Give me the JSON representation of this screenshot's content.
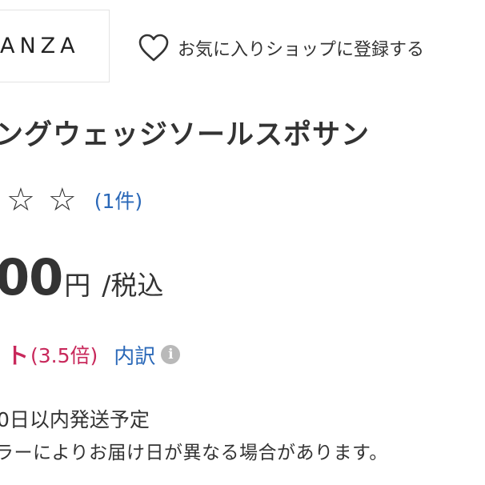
{
  "brand": {
    "logo_text": "ANZA"
  },
  "favorite": {
    "icon": "heart-outline-icon",
    "label": "お気に入りショップに登録する"
  },
  "product": {
    "title": "ングウェッジソールスポサン"
  },
  "rating": {
    "stars": [
      "☆",
      "☆"
    ],
    "review_count": "(1件)"
  },
  "price": {
    "value": "00",
    "currency": "円",
    "tax": "/税込"
  },
  "points": {
    "suffix": "ト",
    "rate": "(3.5倍)",
    "breakdown_label": "内訳",
    "info_icon": "i"
  },
  "shipping": {
    "line1": "0日以内発送予定",
    "line2": "ラーによりお届け日が異なる場合があります。"
  },
  "colors": {
    "link": "#2a68b8",
    "points": "#c8285b",
    "text": "#333333"
  }
}
